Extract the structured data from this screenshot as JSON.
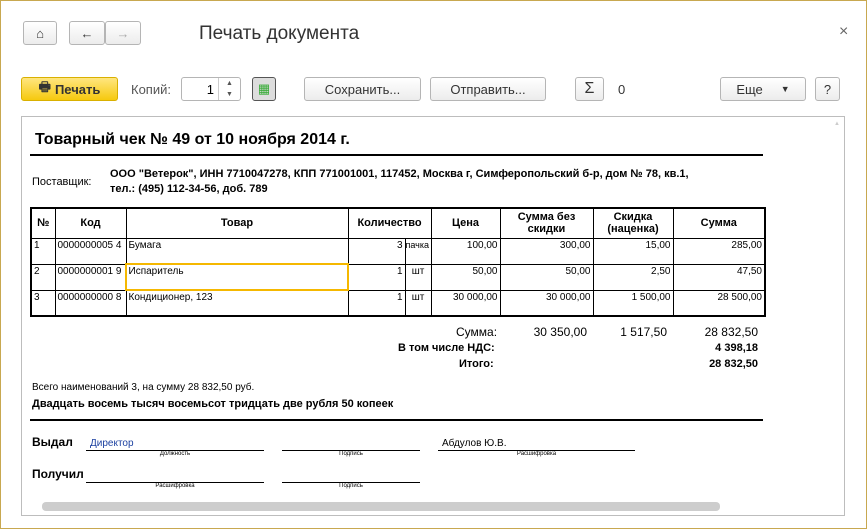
{
  "window": {
    "title": "Печать документа",
    "close": "×"
  },
  "toolbar": {
    "print": "Печать",
    "copies_label": "Копий:",
    "copies_value": "1",
    "save": "Сохранить...",
    "send": "Отправить...",
    "sum_value": "0",
    "more": "Еще",
    "help": "?"
  },
  "doc": {
    "title": "Товарный чек № 49 от 10 ноября 2014 г.",
    "supplier_label": "Поставщик:",
    "supplier_line1": "ООО \"Ветерок\",  ИНН 7710047278,  КПП 771001001,  117452, Москва г, Симферопольский б-р, дом № 78, кв.1,",
    "supplier_line2": "тел.: (495) 112-34-56, доб. 789",
    "headers": [
      "№",
      "Код",
      "Товар",
      "Количество",
      "Цена",
      "Сумма без скидки",
      "Скидка (наценка)",
      "Сумма"
    ],
    "rows": [
      {
        "n": "1",
        "code": "0000000005 4",
        "name": "Бумага",
        "qty": "3",
        "unit": "пачка",
        "price": "100,00",
        "sum_no_disc": "300,00",
        "disc": "15,00",
        "sum": "285,00"
      },
      {
        "n": "2",
        "code": "0000000001 9",
        "name": "Испаритель",
        "qty": "1",
        "unit": "шт",
        "price": "50,00",
        "sum_no_disc": "50,00",
        "disc": "2,50",
        "sum": "47,50"
      },
      {
        "n": "3",
        "code": "0000000000 8",
        "name": "Кондиционер, 123",
        "qty": "1",
        "unit": "шт",
        "price": "30 000,00",
        "sum_no_disc": "30 000,00",
        "disc": "1 500,00",
        "sum": "28 500,00"
      }
    ],
    "totals": {
      "sum_label": "Сумма:",
      "sum_no_disc": "30 350,00",
      "disc": "1 517,50",
      "sum": "28 832,50",
      "vat_label": "В том числе НДС:",
      "vat": "4 398,18",
      "total_label": "Итого:",
      "total": "28 832,50"
    },
    "count_line": "Всего наименований 3, на сумму 28 832,50 руб.",
    "words_line": "Двадцать восемь тысяч восемьсот тридцать две рубля 50 копеек",
    "issued_label": "Выдал",
    "issued_position": "Директор",
    "issued_name": "Абдулов Ю.В.",
    "received_label": "Получил",
    "cap_position": "Должность",
    "cap_sign": "Подпись",
    "cap_decode": "Расшифровка"
  }
}
